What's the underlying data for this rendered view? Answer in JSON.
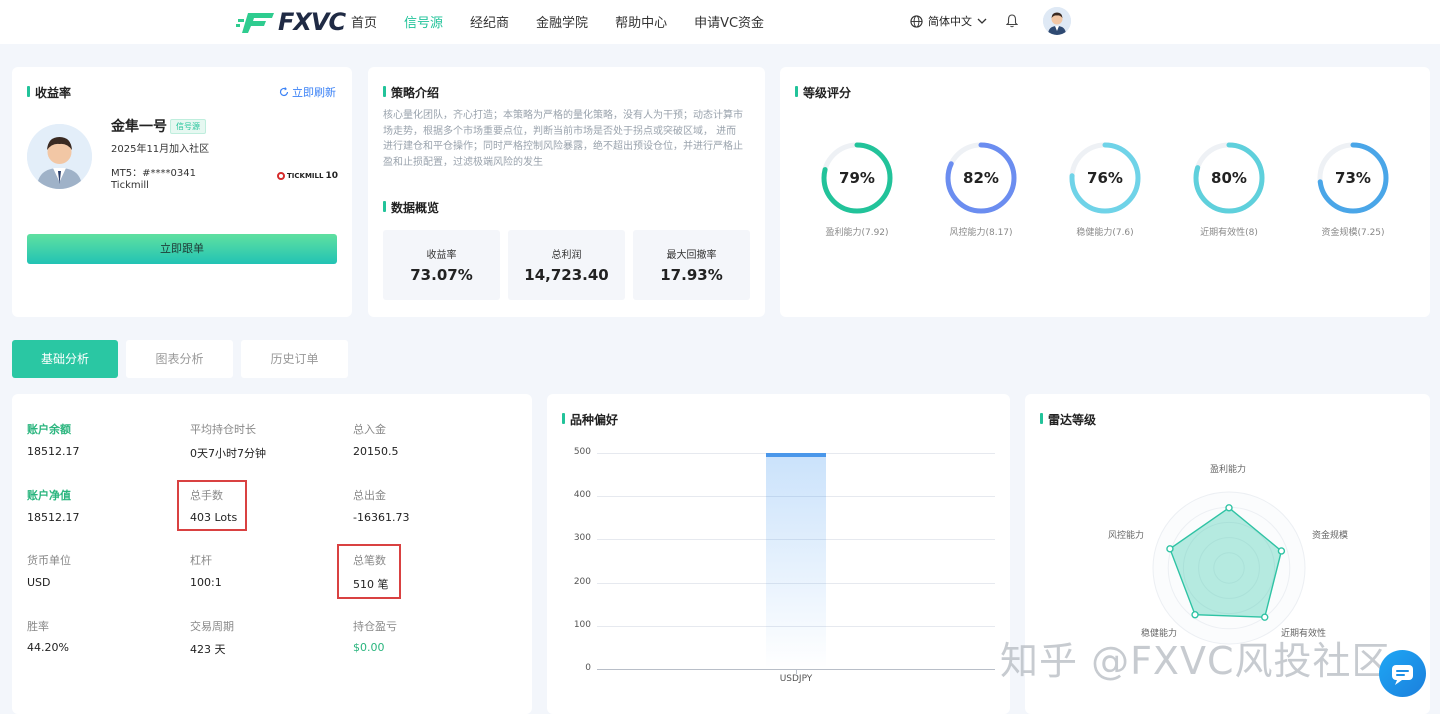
{
  "nav": {
    "logo_text": "FXVC",
    "links": [
      "首页",
      "信号源",
      "经纪商",
      "金融学院",
      "帮助中心",
      "申请VC资金"
    ],
    "active_index": 1,
    "language": "简体中文"
  },
  "profile": {
    "title": "收益率",
    "refresh_label": "立即刷新",
    "name": "金隼一号",
    "badge": "信号源",
    "joined": "2025年11月加入社区",
    "mt5": "MT5：#****0341",
    "broker": "Tickmill",
    "broker_logo_text": "TICKMILL",
    "broker_logo_num": "10",
    "follow_label": "立即跟单"
  },
  "strategy": {
    "title": "策略介绍",
    "text": "核心量化团队，齐心打造；本策略为严格的量化策略，没有人为干预；动态计算市场走势，根据多个市场重要点位，判断当前市场是否处于拐点或突破区域， 进而进行建仓和平仓操作；同时严格控制风险暴露，绝不超出预设仓位，并进行严格止盈和止损配置，过滤极端风险的发生",
    "overview_title": "数据概览",
    "stats": [
      {
        "label": "收益率",
        "value": "73.07%"
      },
      {
        "label": "总利润",
        "value": "14,723.40"
      },
      {
        "label": "最大回撤率",
        "value": "17.93%"
      }
    ]
  },
  "rating": {
    "title": "等级评分",
    "items": [
      {
        "pct": "79%",
        "value": 79,
        "label": "盈利能力(7.92)",
        "color": "#22c39a"
      },
      {
        "pct": "82%",
        "value": 82,
        "label": "风控能力(8.17)",
        "color": "#6b8df0"
      },
      {
        "pct": "76%",
        "value": 76,
        "label": "稳健能力(7.6)",
        "color": "#6fd3e8"
      },
      {
        "pct": "80%",
        "value": 80,
        "label": "近期有效性(8)",
        "color": "#5fd0dc"
      },
      {
        "pct": "73%",
        "value": 73,
        "label": "资金规模(7.25)",
        "color": "#4aa6e8"
      }
    ]
  },
  "tabs": [
    "基础分析",
    "图表分析",
    "历史订单"
  ],
  "account": {
    "cells": [
      {
        "label": "账户余额",
        "value": "18512.17",
        "green_label": true
      },
      {
        "label": "平均持仓时长",
        "value": "0天7小时7分钟"
      },
      {
        "label": "总入金",
        "value": "20150.5"
      },
      {
        "label": "账户净值",
        "value": "18512.17",
        "green_label": true
      },
      {
        "label": "总手数",
        "value": "403 Lots"
      },
      {
        "label": "总出金",
        "value": "-16361.73"
      },
      {
        "label": "货币单位",
        "value": "USD"
      },
      {
        "label": "杠杆",
        "value": "100:1"
      },
      {
        "label": "总笔数",
        "value": "510 笔"
      },
      {
        "label": "胜率",
        "value": "44.20%"
      },
      {
        "label": "交易周期",
        "value": "423 天"
      },
      {
        "label": "持仓盈亏",
        "value": "$0.00",
        "green_value": true
      }
    ]
  },
  "chart_data": {
    "type": "bar",
    "title": "品种偏好",
    "categories": [
      "USDJPY"
    ],
    "values": [
      500
    ],
    "ylim": [
      0,
      500
    ],
    "yticks": [
      0,
      100,
      200,
      300,
      400,
      500
    ]
  },
  "radar": {
    "title": "雷达等级",
    "axes": [
      "盈利能力",
      "资金规模",
      "近期有效性",
      "稳健能力",
      "风控能力"
    ],
    "values": [
      7.92,
      7.25,
      8,
      7.6,
      8.17
    ],
    "max": 10
  },
  "watermark": "知乎 @FXVC风投社区"
}
